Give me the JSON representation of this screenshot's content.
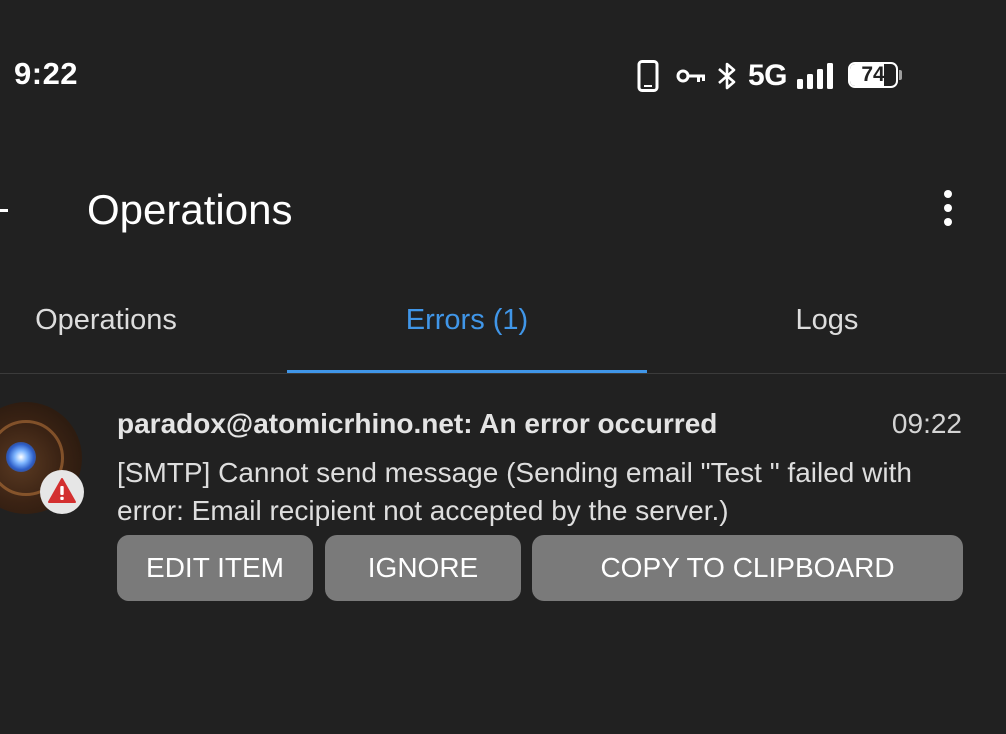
{
  "status_bar": {
    "time": "9:22",
    "network_type": "5G",
    "battery_level": "74",
    "battery_fraction": 0.74,
    "icons": [
      "phone-icon",
      "vpn-key-icon",
      "bluetooth-icon",
      "signal-icon",
      "battery-icon"
    ]
  },
  "app_bar": {
    "title": "Operations",
    "back_icon": "back-arrow-icon",
    "menu_icon": "more-vert-icon"
  },
  "tabs": [
    {
      "label": "Operations",
      "selected": false
    },
    {
      "label": "Errors (1)",
      "selected": true
    },
    {
      "label": "Logs",
      "selected": false
    }
  ],
  "colors": {
    "background": "#212121",
    "accent": "#4096e8",
    "button": "#7a7a7a",
    "warning": "#d32f2f"
  },
  "error": {
    "account": "paradox@atomicrhino.net: An error occurred",
    "time": "09:22",
    "message": "[SMTP] Cannot send message (Sending email \"Test \" failed with error: Email recipient not accepted by the server.)",
    "badge_icon": "warning-icon",
    "actions": {
      "edit": "EDIT ITEM",
      "ignore": "IGNORE",
      "copy": "COPY TO CLIPBOARD"
    }
  }
}
